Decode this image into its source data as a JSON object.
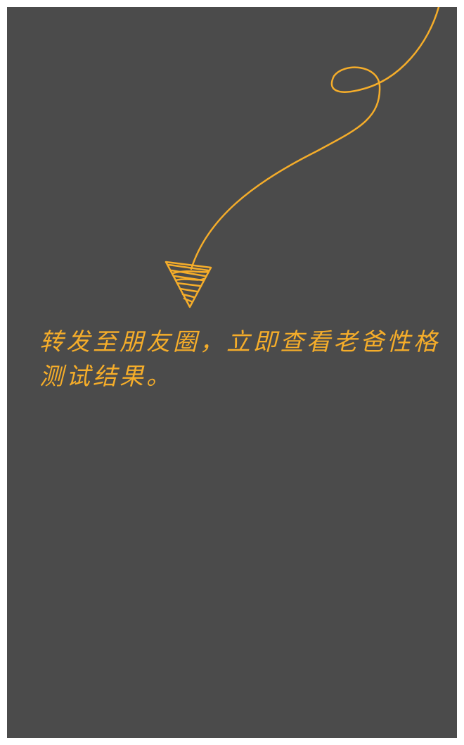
{
  "overlay": {
    "hint_text": "转发至朋友圈，立即查看老爸性格测试结果。",
    "pointer_icon": "hand-drawn-arrow-icon",
    "accent_color": "#f5ad2a",
    "background_color": "#4b4b4b"
  }
}
